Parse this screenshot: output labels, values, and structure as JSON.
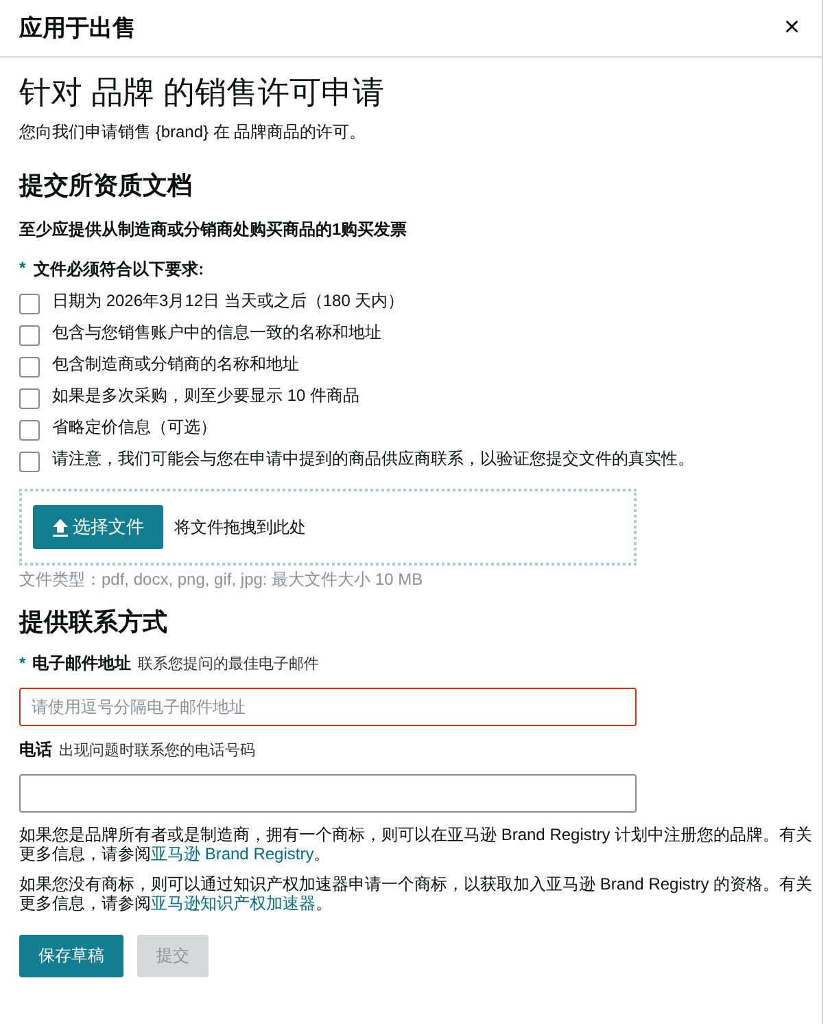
{
  "dialog": {
    "title": "应用于出售",
    "close": "×"
  },
  "heading": "针对 品牌 的销售许可申请",
  "intro": "您向我们申请销售 {brand} 在 品牌商品的许可。",
  "documents": {
    "title": "提交所资质文档",
    "requirement": "至少应提供从制造商或分销商处购买商品的1购买发票",
    "list_label": {
      "required_mark": "*",
      "text": "文件必须符合以下要求:"
    },
    "checklist": [
      {
        "label": "日期为 2026年3月12日 当天或之后（180 天内）",
        "checked": false
      },
      {
        "label": "包含与您销售账户中的信息一致的名称和地址",
        "checked": false
      },
      {
        "label": "包含制造商或分销商的名称和地址",
        "checked": false
      },
      {
        "label": "如果是多次采购，则至少要显示 10 件商品",
        "checked": false
      },
      {
        "label": "省略定价信息（可选）",
        "checked": false
      },
      {
        "label": "请注意，我们可能会与您在申请中提到的商品供应商联系，以验证您提交文件的真实性。",
        "checked": false
      }
    ],
    "upload": {
      "button": "选择文件",
      "hint": "将文件拖拽到此处",
      "file_types": "文件类型：pdf, docx, png, gif, jpg: 最大文件大小 10 MB"
    }
  },
  "contact": {
    "title": "提供联系方式",
    "fields": [
      {
        "required_mark": "*",
        "label": "电子邮件地址",
        "hint": "联系您提问的最佳电子邮件",
        "placeholder": "请使用逗号分隔电子邮件地址",
        "invalid": true
      },
      {
        "label": "电话",
        "hint": "出现问题时联系您的电话号码",
        "invalid": false
      }
    ]
  },
  "notes": [
    {
      "text": "如果您是品牌所有者或是制造商，拥有一个商标，则可以在亚马逊 Brand Registry 计划中注册您的品牌。有关更多信息，请参阅",
      "link": "亚马逊 Brand Registry",
      "end": "。"
    },
    {
      "text": "如果您没有商标，则可以通过知识产权加速器申请一个商标，以获取加入亚马逊 Brand Registry 的资格。有关更多信息，请参阅",
      "link": "亚马逊知识产权加速器",
      "end": "。"
    }
  ],
  "buttons": [
    {
      "label": "保存草稿",
      "kind": "primary",
      "disabled": false
    },
    {
      "label": "提交",
      "kind": "secondary",
      "disabled": true
    }
  ]
}
